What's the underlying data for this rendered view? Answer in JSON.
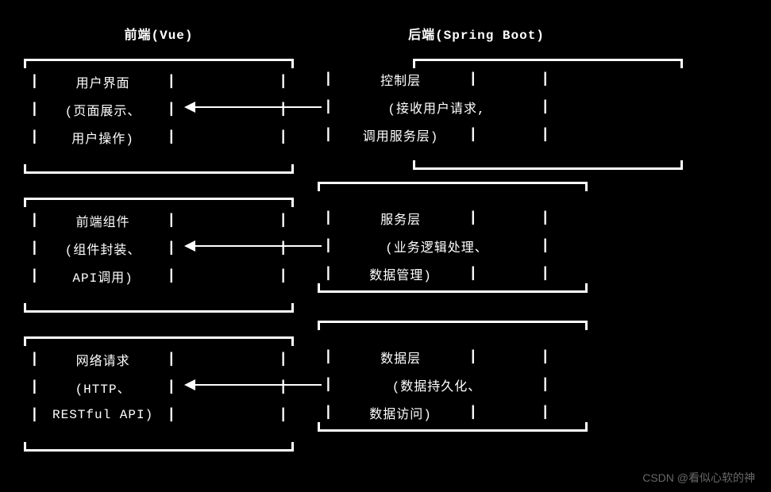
{
  "header": {
    "frontend": "前端(Vue)",
    "backend": "后端(Spring Boot)"
  },
  "rows": [
    {
      "front": {
        "line1": "用户界面",
        "line2": "(页面展示、",
        "line3": "用户操作)"
      },
      "back": {
        "line1": "控制层",
        "line2": "(接收用户请求,",
        "line3": "调用服务层)"
      }
    },
    {
      "front": {
        "line1": "前端组件",
        "line2": "(组件封装、",
        "line3": "API调用)"
      },
      "back": {
        "line1": "服务层",
        "line2": "(业务逻辑处理、",
        "line3": "数据管理)"
      }
    },
    {
      "front": {
        "line1": "网络请求",
        "line2": "(HTTP、",
        "line3": "RESTful API)"
      },
      "back": {
        "line1": "数据层",
        "line2": "(数据持久化、",
        "line3": "数据访问)"
      }
    }
  ],
  "pipe": "|",
  "watermark": "CSDN @看似心软的神"
}
